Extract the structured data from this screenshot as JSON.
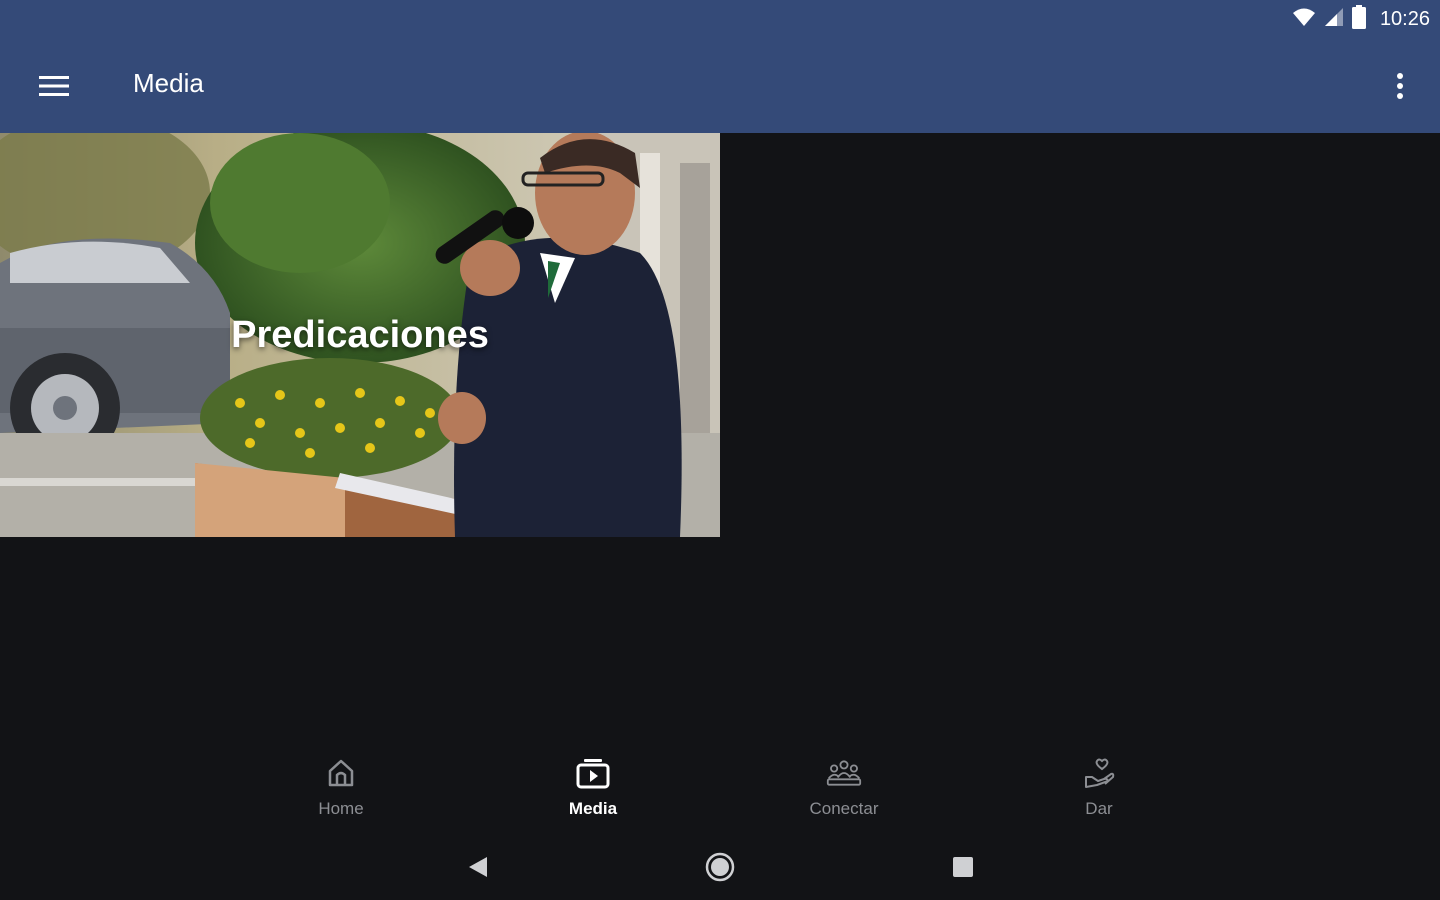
{
  "status_bar": {
    "time": "10:26",
    "icons": [
      "wifi-icon",
      "cell-signal-icon",
      "battery-icon"
    ]
  },
  "toolbar": {
    "title": "Media",
    "menu_icon": "hamburger-menu-icon",
    "overflow_icon": "more-vert-icon"
  },
  "media": {
    "items": [
      {
        "title": "Predicaciones"
      }
    ]
  },
  "bottom_nav": {
    "items": [
      {
        "label": "Home",
        "icon": "home-icon",
        "active": false
      },
      {
        "label": "Media",
        "icon": "media-icon",
        "active": true
      },
      {
        "label": "Conectar",
        "icon": "people-icon",
        "active": false
      },
      {
        "label": "Dar",
        "icon": "give-icon",
        "active": false
      }
    ]
  },
  "system_nav": {
    "icons": [
      "back-icon",
      "home-circle-icon",
      "recents-icon"
    ]
  },
  "colors": {
    "app_bar": "#344a78",
    "background": "#121316",
    "nav_inactive": "#8c8e93",
    "nav_active": "#ffffff"
  }
}
